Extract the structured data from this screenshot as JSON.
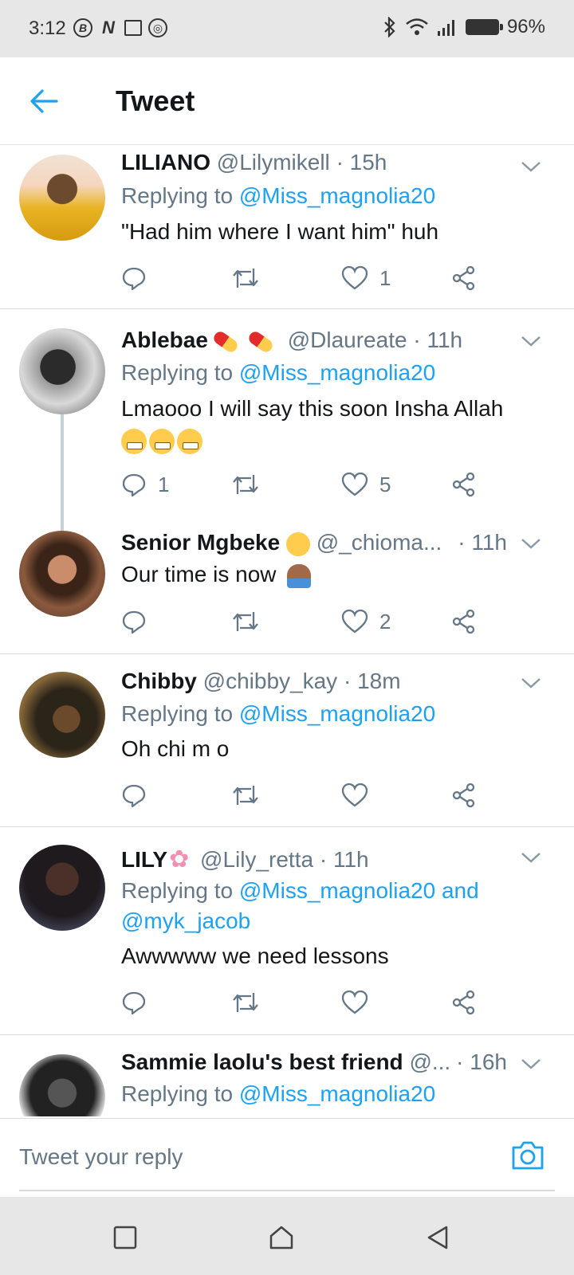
{
  "status_bar": {
    "time": "3:12",
    "battery": "96%"
  },
  "header": {
    "title": "Tweet"
  },
  "colors": {
    "accent": "#1da1f2",
    "secondary_text": "#657786"
  },
  "tweets": [
    {
      "name": "LILIANO",
      "handle": "@Lilymikell",
      "time": "· 15h",
      "replying_prefix": "Replying to ",
      "replying_to": "@Miss_magnolia20",
      "text": "\"Had him where I want him\" huh",
      "likes": "1"
    },
    {
      "name": "Ablebae",
      "handle": "@Dlaureate",
      "time": "· 11h",
      "replying_prefix": "Replying to ",
      "replying_to": "@Miss_magnolia20",
      "text": "Lmaooo I will say this soon Insha Allah",
      "replies": "1",
      "likes": "5"
    },
    {
      "name": "Senior Mgbeke",
      "handle": "@_chioma...",
      "time": "· 11h",
      "text": "Our time is now",
      "likes": "2"
    },
    {
      "name": "Chibby",
      "handle": "@chibby_kay",
      "time": "· 18m",
      "replying_prefix": "Replying to ",
      "replying_to": "@Miss_magnolia20",
      "text": "Oh chi m o"
    },
    {
      "name": "LILY",
      "handle": "@Lily_retta",
      "time": "· 11h",
      "replying_prefix": "Replying to ",
      "replying_to": "@Miss_magnolia20 and",
      "replying_to_2": "@myk_jacob",
      "text": "Awwwww we need lessons"
    },
    {
      "name": "Sammie laolu's best friend",
      "handle": "@...",
      "time": "· 16h",
      "replying_prefix": "Replying to ",
      "replying_to": "@Miss_magnolia20"
    }
  ],
  "reply_bar": {
    "placeholder": "Tweet your reply"
  }
}
